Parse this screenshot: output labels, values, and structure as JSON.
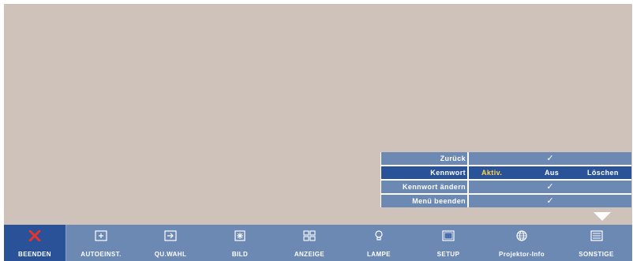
{
  "submenu": {
    "rows": [
      {
        "label": "Zurück",
        "value": "✓"
      },
      {
        "label": "Kennwort",
        "options": [
          "Aktiv.",
          "Aus",
          "Löschen"
        ]
      },
      {
        "label": "Kennwort ändern",
        "value": "✓"
      },
      {
        "label": "Menü beenden",
        "value": "✓"
      }
    ]
  },
  "menubar": {
    "items": [
      {
        "label": "BEENDEN",
        "icon": "close-icon"
      },
      {
        "label": "AUTOEINST.",
        "icon": "auto-adjust-icon"
      },
      {
        "label": "QU.WAHL",
        "icon": "input-source-icon"
      },
      {
        "label": "BILD",
        "icon": "picture-icon"
      },
      {
        "label": "ANZEIGE",
        "icon": "display-icon"
      },
      {
        "label": "LAMPE",
        "icon": "lamp-icon"
      },
      {
        "label": "SETUP",
        "icon": "setup-icon"
      },
      {
        "label": "Projektor-Info",
        "icon": "globe-icon"
      },
      {
        "label": "SONSTIGE",
        "icon": "others-icon"
      }
    ]
  },
  "colors": {
    "background": "#cec2bb",
    "menu_blue": "#6c89b4",
    "selected_blue": "#2a5298",
    "active_option": "#ffd64a",
    "close_red": "#e8322a"
  }
}
